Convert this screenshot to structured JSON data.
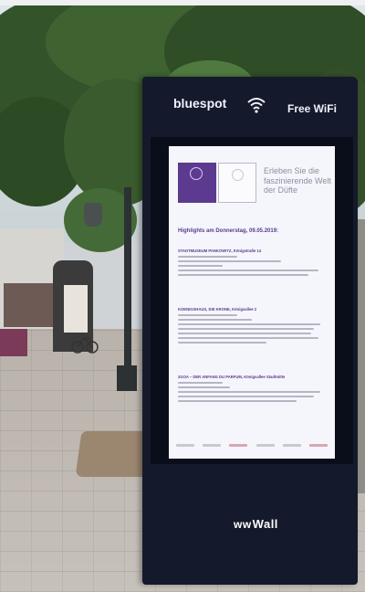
{
  "totem": {
    "brand_left": "bluespot",
    "brand_right": "Free WiFi",
    "wifi_icon": "wifi-icon",
    "bottom_logo": "Wall",
    "bottom_logo_mark": "ww",
    "frame_color": "#141a2c"
  },
  "screen": {
    "tagline": "Erleben Sie die faszinierende Welt der Düfte",
    "heading": "Highlights am Donnerstag, 09.05.2019:",
    "accent_color": "#5b3a8f",
    "events": [
      {
        "title": "STADTMUSEUM PANKOWITZ, Königstraße 14"
      },
      {
        "title": "KOENIGSHAUS, DIE KRONE, Königsallee 2"
      },
      {
        "title": "2GOA – DER ANFANG DU PARFUM, Königsallee Stadtmitte"
      }
    ]
  }
}
